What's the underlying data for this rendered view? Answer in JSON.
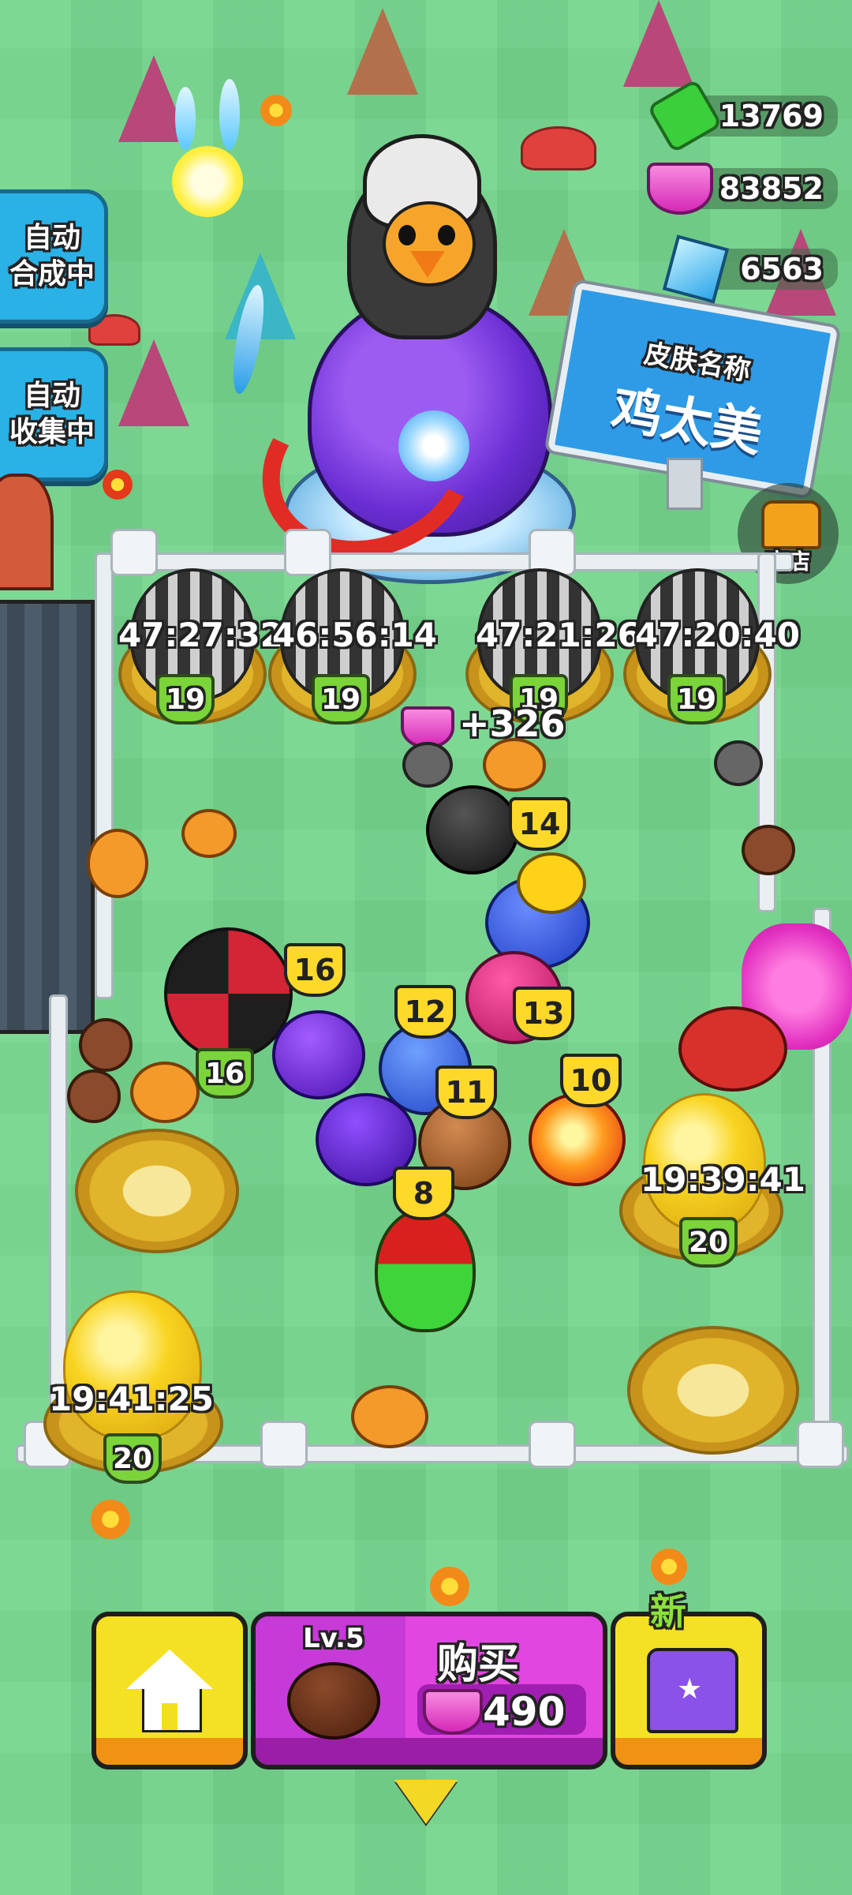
{
  "currencies": [
    {
      "name": "cash",
      "icon": "cash-icon",
      "value": "13769",
      "color": "#3ccf3c"
    },
    {
      "name": "gem",
      "icon": "gem-icon",
      "value": "83852",
      "color": "#e63ec8"
    },
    {
      "name": "crystal",
      "icon": "crystal-icon",
      "value": "6563",
      "color": "#39b9f0"
    }
  ],
  "side_buttons": [
    {
      "label": "自动\n合成中"
    },
    {
      "label": "自动\n收集中"
    }
  ],
  "sign": {
    "subtitle": "皮肤名称",
    "title": "鸡太美"
  },
  "shop": {
    "label": "商店"
  },
  "cage_eggs": [
    {
      "timer": "47:27:32",
      "level": "19"
    },
    {
      "timer": "46:56:14",
      "level": "19"
    },
    {
      "timer": "47:21:26",
      "level": "19"
    },
    {
      "timer": "47:20:40",
      "level": "19"
    }
  ],
  "reward_popup": {
    "text": "+326"
  },
  "creature_levels": [
    "14",
    "16",
    "12",
    "13",
    "11",
    "10",
    "8"
  ],
  "green_levels": [
    "16"
  ],
  "gold_eggs": [
    {
      "timer": "19:39:41",
      "level": "20"
    },
    {
      "timer": "19:41:25",
      "level": "20"
    }
  ],
  "bottom_bar": {
    "home_icon": "home-icon",
    "buy": {
      "level": "Lv.5",
      "label": "购买",
      "price": "490",
      "price_icon": "gem-icon"
    },
    "skin": {
      "badge": "新",
      "icon": "shirt-icon"
    }
  },
  "colors": {
    "grass": "#74d58c",
    "side_button": "#2ab1e6",
    "buy_panel": "#d63ad6",
    "home_button": "#f2df1f",
    "gem": "#e63ec8"
  }
}
